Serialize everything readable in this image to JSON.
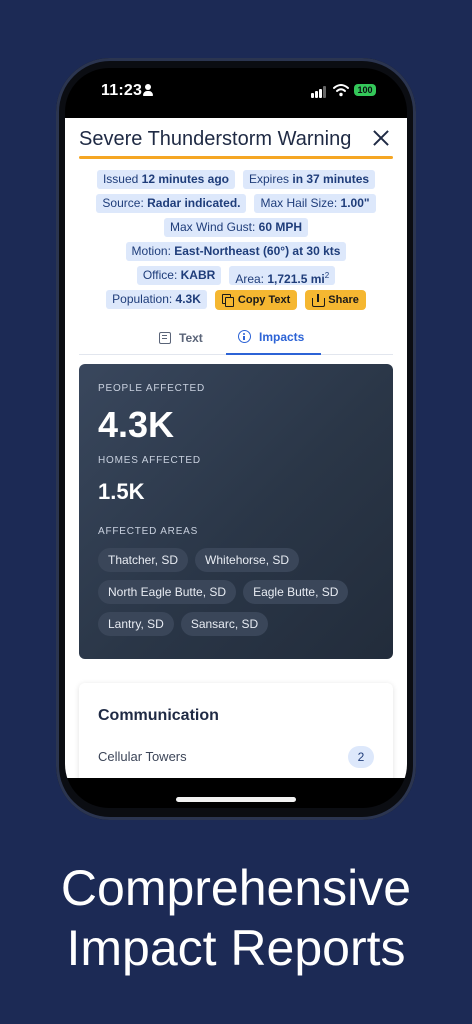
{
  "status_bar": {
    "time": "11:23",
    "battery": "100"
  },
  "header": {
    "title": "Severe Thunderstorm Warning"
  },
  "details": {
    "issued_label": "Issued",
    "issued_value": "12 minutes ago",
    "expires_label": "Expires",
    "expires_value": "in 37 minutes",
    "source_label": "Source:",
    "source_value": "Radar indicated.",
    "hail_label": "Max Hail Size:",
    "hail_value": "1.00\"",
    "wind_label": "Max Wind Gust:",
    "wind_value": "60 MPH",
    "motion_label": "Motion:",
    "motion_value": "East-Northeast (60°) at 30 kts",
    "office_label": "Office:",
    "office_value": "KABR",
    "area_label": "Area:",
    "area_value": "1,721.5 mi",
    "area_sup": "2",
    "population_label": "Population:",
    "population_value": "4.3K"
  },
  "actions": {
    "copy_label": "Copy Text",
    "share_label": "Share"
  },
  "tabs": {
    "text_label": "Text",
    "impacts_label": "Impacts",
    "active": "Impacts"
  },
  "impacts": {
    "people_label": "PEOPLE AFFECTED",
    "people_value": "4.3K",
    "homes_label": "HOMES AFFECTED",
    "homes_value": "1.5K",
    "areas_label": "AFFECTED AREAS",
    "areas": [
      "Thatcher, SD",
      "Whitehorse, SD",
      "North Eagle Butte, SD",
      "Eagle Butte, SD",
      "Lantry, SD",
      "Sansarc, SD"
    ]
  },
  "communication": {
    "title": "Communication",
    "rows": [
      {
        "label": "Cellular Towers",
        "count": "2"
      }
    ]
  },
  "tagline": {
    "line1": "Comprehensive",
    "line2": "Impact Reports"
  },
  "colors": {
    "background": "#1c2a55",
    "accent": "#f5a623",
    "link": "#2c63d6",
    "chip": "#dde8fb"
  }
}
